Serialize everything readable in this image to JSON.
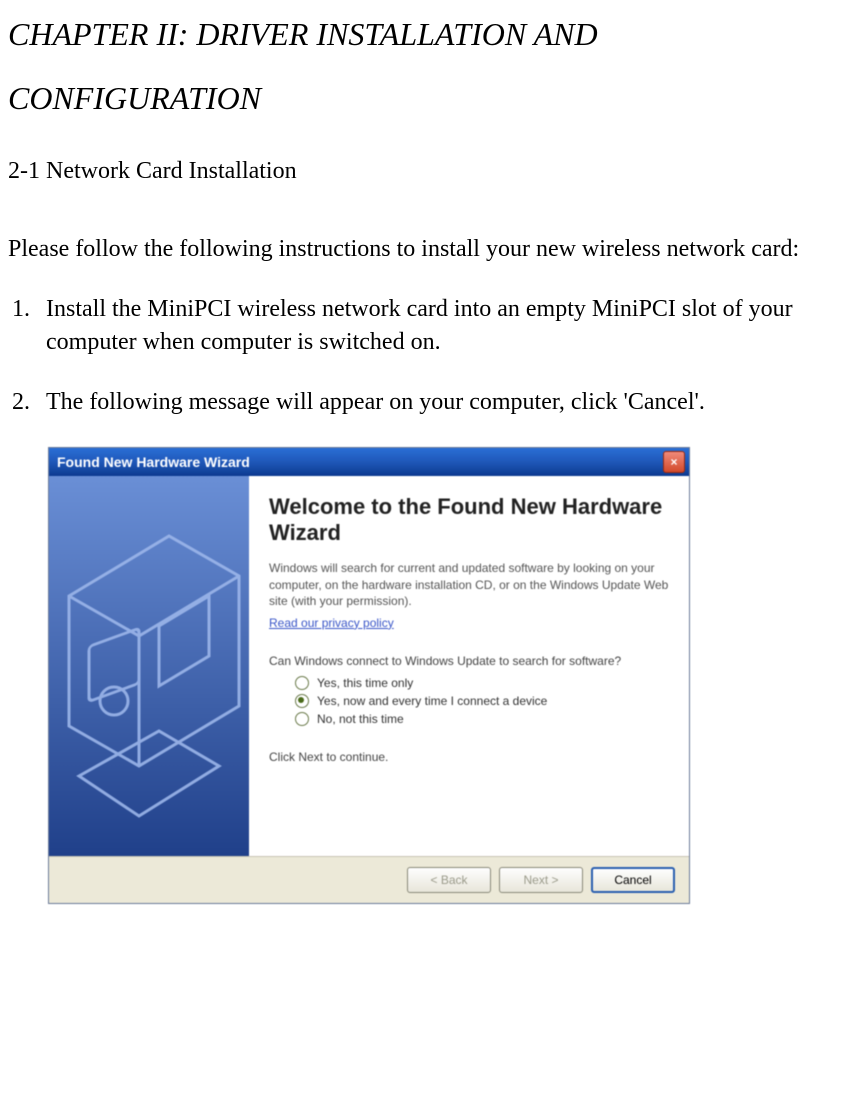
{
  "chapter_title": "CHAPTER II:    DRIVER INSTALLATION AND CONFIGURATION",
  "section_title": "2-1 Network Card Installation",
  "intro": "Please follow the following instructions to install your new wireless network card:",
  "steps": [
    "Install the MiniPCI wireless network card into an empty MiniPCI slot of your computer when computer is switched on.",
    "The following message will appear on your computer, click 'Cancel'."
  ],
  "wizard": {
    "title": "Found New Hardware Wizard",
    "heading": "Welcome to the Found New Hardware Wizard",
    "para": "Windows will search for current and updated software by looking on your computer, on the hardware installation CD, or on the Windows Update Web site (with your permission).",
    "privacy_link": "Read our privacy policy",
    "question": "Can Windows connect to Windows Update to search for software?",
    "options": [
      {
        "label": "Yes, this time only",
        "selected": false
      },
      {
        "label": "Yes, now and every time I connect a device",
        "selected": true
      },
      {
        "label": "No, not this time",
        "selected": false
      }
    ],
    "continue_text": "Click Next to continue.",
    "buttons": {
      "back": "< Back",
      "next": "Next >",
      "cancel": "Cancel"
    },
    "close_icon": "×"
  }
}
